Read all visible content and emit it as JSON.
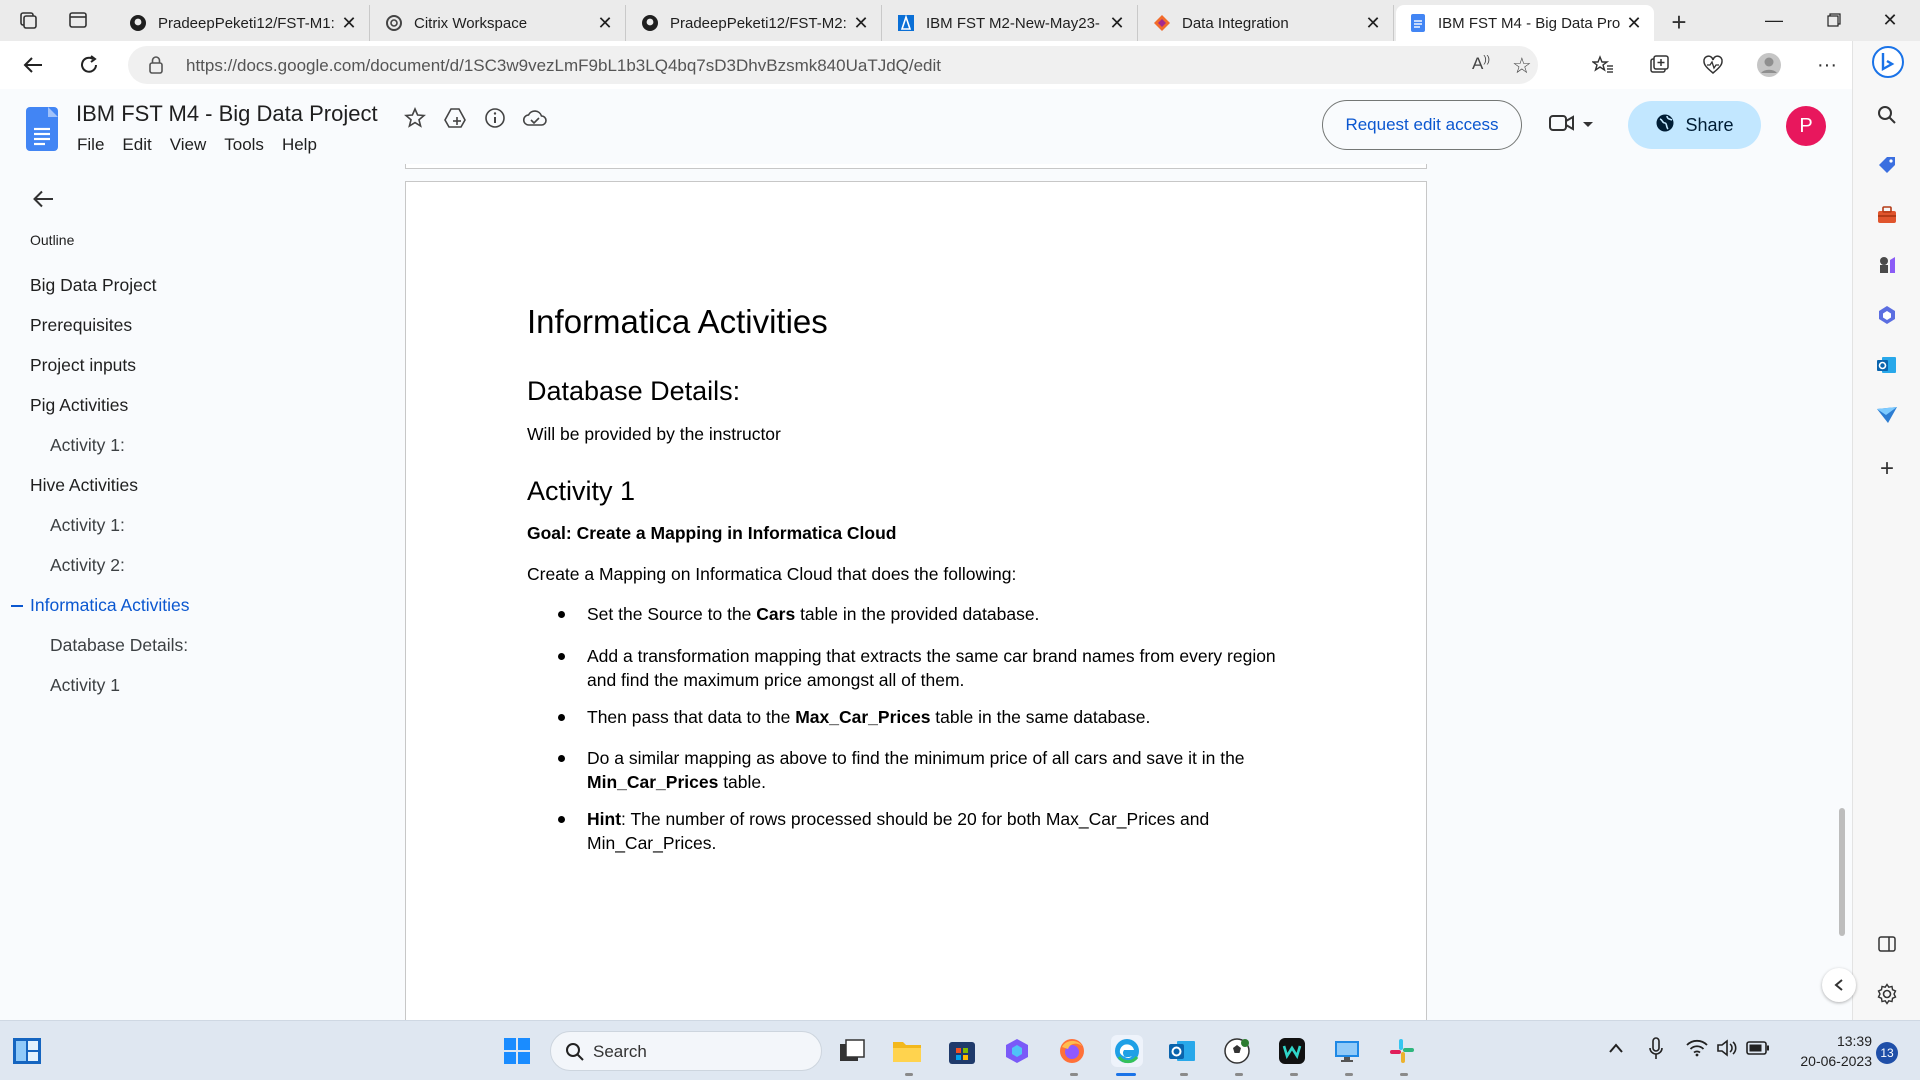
{
  "browser": {
    "tabs": [
      {
        "label": "PradeepPeketi12/FST-M1:",
        "icon": "github-icon"
      },
      {
        "label": "Citrix Workspace",
        "icon": "citrix-icon"
      },
      {
        "label": "PradeepPeketi12/FST-M2:",
        "icon": "github-icon"
      },
      {
        "label": "IBM FST M2-New-May23-",
        "icon": "azure-icon"
      },
      {
        "label": "Data Integration",
        "icon": "informatica-icon"
      },
      {
        "label": "IBM FST M4 - Big Data Pro",
        "icon": "docs-icon",
        "active": true
      }
    ],
    "url": "https://docs.google.com/document/d/1SC3w9vezLmF9bL1b3LQ4bq7sD3DhvBzsmk840UaTJdQ/edit"
  },
  "docs": {
    "title": "IBM FST M4 - Big Data Project",
    "menu": [
      "File",
      "Edit",
      "View",
      "Tools",
      "Help"
    ],
    "request_edit": "Request edit access",
    "share": "Share",
    "avatar_letter": "P"
  },
  "outline": {
    "label": "Outline",
    "items": [
      {
        "label": "Big Data Project",
        "level": 1
      },
      {
        "label": "Prerequisites",
        "level": 1
      },
      {
        "label": "Project inputs",
        "level": 1
      },
      {
        "label": "Pig Activities",
        "level": 1
      },
      {
        "label": "Activity 1:",
        "level": 2
      },
      {
        "label": "Hive Activities",
        "level": 1
      },
      {
        "label": "Activity 1:",
        "level": 2
      },
      {
        "label": "Activity 2:",
        "level": 2
      },
      {
        "label": "Informatica Activities",
        "level": 1,
        "selected": true
      },
      {
        "label": "Database Details:",
        "level": 2
      },
      {
        "label": "Activity 1",
        "level": 2
      }
    ]
  },
  "document": {
    "h1": "Informatica Activities",
    "h2_db": "Database Details:",
    "db_text": "Will be provided by the instructor",
    "h2_activity": "Activity 1",
    "goal": "Goal: Create a Mapping in Informatica Cloud",
    "intro": "Create a Mapping on Informatica Cloud that does the following:",
    "bullets": {
      "b1_pre": "Set the Source to the ",
      "b1_bold": "Cars",
      "b1_post": " table in the provided database.",
      "b2": "Add a transformation mapping that extracts the same car brand names from every region and find the maximum price amongst all of them.",
      "b3_pre": "Then pass that data to the ",
      "b3_bold": "Max_Car_Prices",
      "b3_post": " table in the same database.",
      "b4_pre": "Do a similar mapping as above to find the minimum price of all cars and save it in the ",
      "b4_bold": "Min_Car_Prices",
      "b4_post": " table.",
      "b5_bold": "Hint",
      "b5_post": ": The number of rows processed should be 20 for both Max_Car_Prices and Min_Car_Prices."
    }
  },
  "taskbar": {
    "search": "Search",
    "time": "13:39",
    "date": "20-06-2023",
    "notifications": "13"
  }
}
